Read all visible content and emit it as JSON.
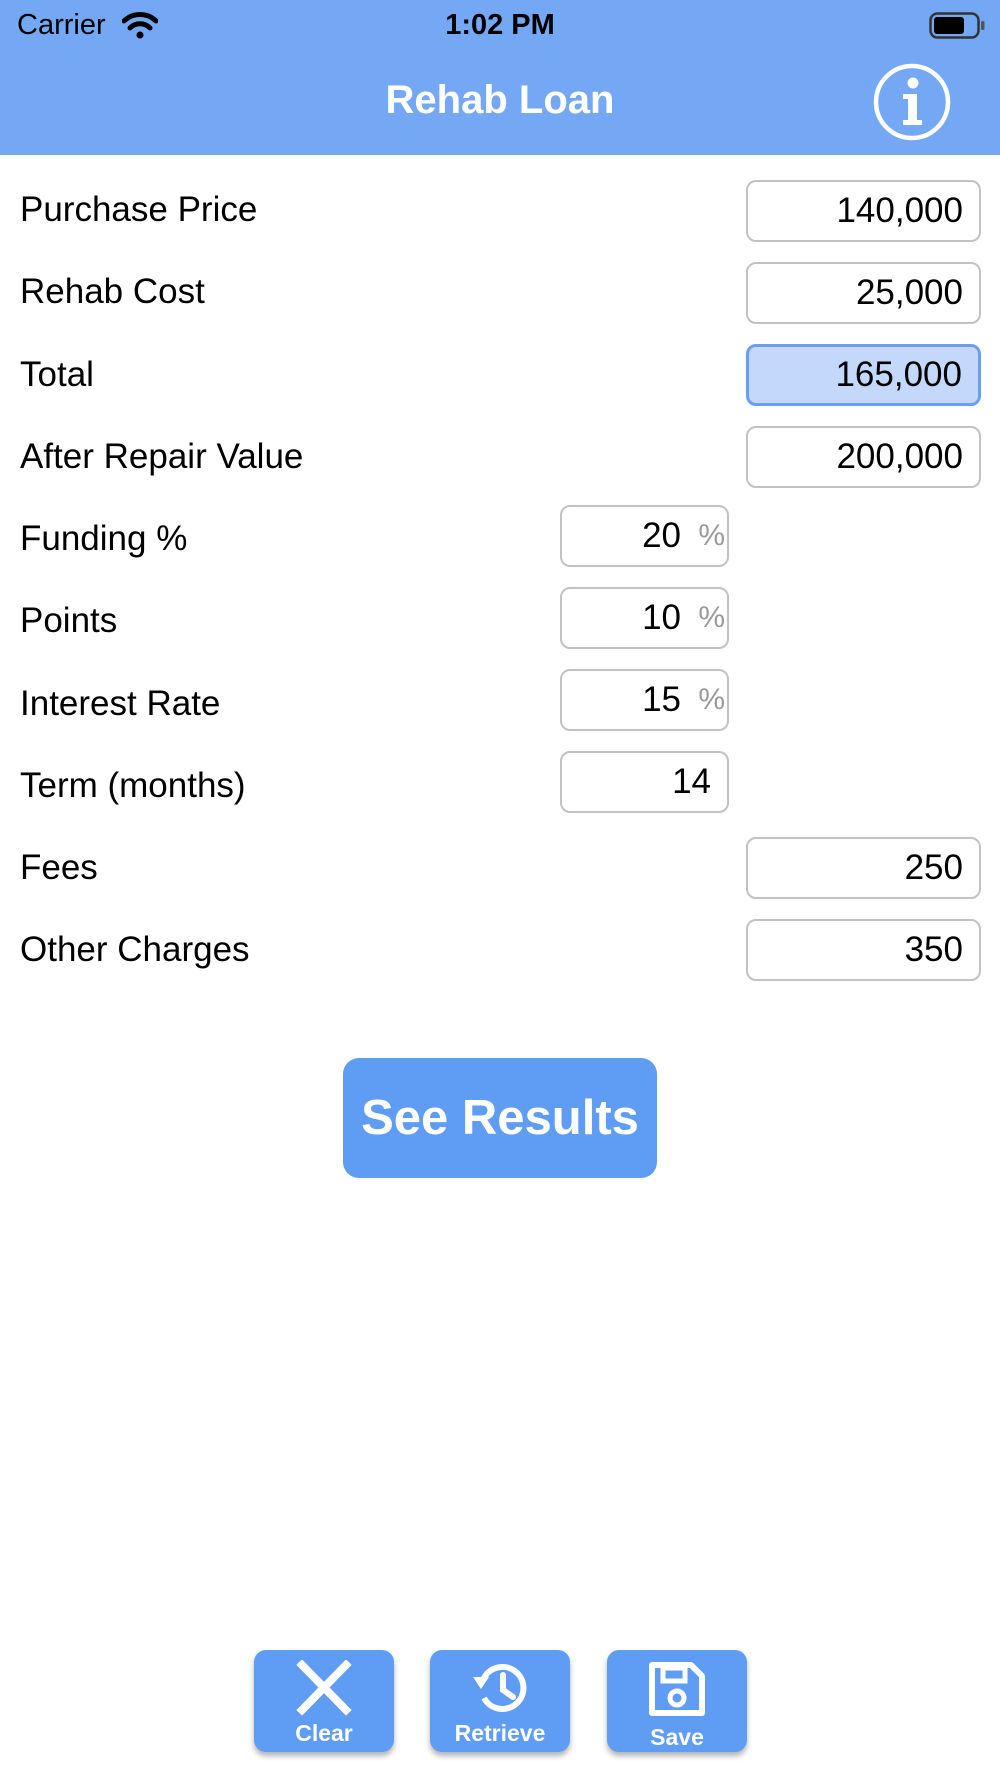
{
  "status_bar": {
    "carrier": "Carrier",
    "time": "1:02 PM"
  },
  "nav": {
    "title": "Rehab Loan",
    "info_icon": "info-circle-icon"
  },
  "form": {
    "purchase_price": {
      "label": "Purchase Price",
      "value": "140,000"
    },
    "rehab_cost": {
      "label": "Rehab Cost",
      "value": "25,000"
    },
    "total": {
      "label": "Total",
      "value": "165,000"
    },
    "after_repair_value": {
      "label": "After Repair Value",
      "value": "200,000"
    },
    "funding_pct": {
      "label": "Funding %",
      "value": "20",
      "unit": "%"
    },
    "points": {
      "label": "Points",
      "value": "10",
      "unit": "%"
    },
    "interest_rate": {
      "label": "Interest Rate",
      "value": "15",
      "unit": "%"
    },
    "term_months": {
      "label": "Term (months)",
      "value": "14"
    },
    "fees": {
      "label": "Fees",
      "value": "250"
    },
    "other_charges": {
      "label": "Other Charges",
      "value": "350"
    }
  },
  "actions": {
    "see_results": "See Results"
  },
  "toolbar": {
    "clear": "Clear",
    "retrieve": "Retrieve",
    "save": "Save"
  },
  "colors": {
    "nav_bar": "#75a8f4",
    "button": "#5f9cf3",
    "active_field": "#c4d8fb"
  }
}
